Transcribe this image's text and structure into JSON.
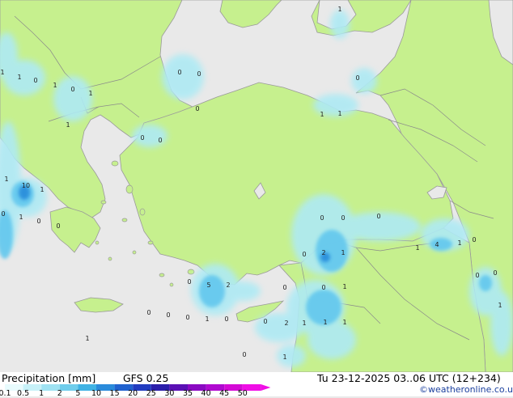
{
  "title": {
    "variable": "Precipitation [mm]",
    "model": "GFS 0.25",
    "valid_time": "Tu 23-12-2025 03..06 UTC (12+234)"
  },
  "credit": "©weatheronline.co.uk",
  "colors": {
    "sea": "#e9e9e9",
    "land": "#c6f08e",
    "coast": "#9a9a9a",
    "border": "#8a8a8a",
    "light_precip": "#aeeaf4",
    "medium_precip": "#62c7ee",
    "heavy_precip": "#2a8fdc"
  },
  "legend": {
    "scale": [
      {
        "label": "0.1",
        "color": "#e8fbfd"
      },
      {
        "label": "0.5",
        "color": "#c7f1f8"
      },
      {
        "label": "1",
        "color": "#9fe2f2"
      },
      {
        "label": "2",
        "color": "#6fcdec"
      },
      {
        "label": "5",
        "color": "#3fb2e4"
      },
      {
        "label": "10",
        "color": "#2a8bdb"
      },
      {
        "label": "15",
        "color": "#2162cf"
      },
      {
        "label": "20",
        "color": "#213cc0"
      },
      {
        "label": "25",
        "color": "#2a1eaa"
      },
      {
        "label": "30",
        "color": "#5a10b4"
      },
      {
        "label": "35",
        "color": "#8a0ac2"
      },
      {
        "label": "40",
        "color": "#b00ad0"
      },
      {
        "label": "45",
        "color": "#d40ad6"
      },
      {
        "label": "50",
        "color": "#f00ee6"
      }
    ]
  },
  "value_labels": [
    {
      "text": "1"
    },
    {
      "text": "1"
    },
    {
      "text": "0"
    },
    {
      "text": "1"
    },
    {
      "text": "0"
    },
    {
      "text": "1"
    },
    {
      "text": "1"
    },
    {
      "text": "0"
    },
    {
      "text": "0"
    },
    {
      "text": "0"
    },
    {
      "text": "0"
    },
    {
      "text": "0"
    },
    {
      "text": "1"
    },
    {
      "text": "1"
    },
    {
      "text": "0"
    },
    {
      "text": "1"
    },
    {
      "text": "10"
    },
    {
      "text": "1"
    },
    {
      "text": "0"
    },
    {
      "text": "1"
    },
    {
      "text": "0"
    },
    {
      "text": "0"
    },
    {
      "text": "1"
    },
    {
      "text": "0"
    },
    {
      "text": "0"
    },
    {
      "text": "0"
    },
    {
      "text": "1"
    },
    {
      "text": "4"
    },
    {
      "text": "1"
    },
    {
      "text": "0"
    },
    {
      "text": "0"
    },
    {
      "text": "2"
    },
    {
      "text": "1"
    },
    {
      "text": "0"
    },
    {
      "text": "0"
    },
    {
      "text": "1"
    },
    {
      "text": "0"
    },
    {
      "text": "5"
    },
    {
      "text": "2"
    },
    {
      "text": "0"
    },
    {
      "text": "0"
    },
    {
      "text": "0"
    },
    {
      "text": "1"
    },
    {
      "text": "0"
    },
    {
      "text": "0"
    },
    {
      "text": "2"
    },
    {
      "text": "1"
    },
    {
      "text": "1"
    },
    {
      "text": "1"
    },
    {
      "text": "1"
    },
    {
      "text": "0"
    },
    {
      "text": "1"
    },
    {
      "text": "0"
    },
    {
      "text": "1"
    },
    {
      "text": "0"
    }
  ]
}
